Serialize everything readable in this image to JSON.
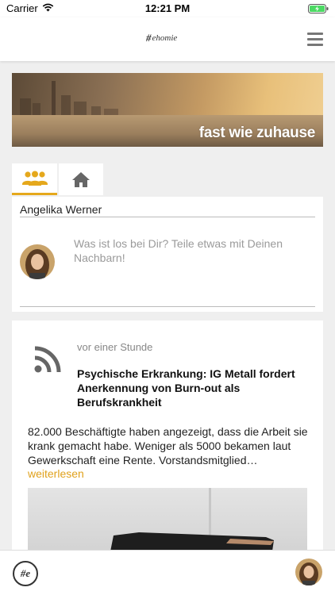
{
  "status_bar": {
    "carrier": "Carrier",
    "time": "12:21 PM"
  },
  "header": {
    "logo_text": "ehomie",
    "logo_mark": "#"
  },
  "banner": {
    "text": "fast wie zuhause"
  },
  "tabs": [
    {
      "icon": "people-icon",
      "active": true
    },
    {
      "icon": "home-icon",
      "active": false
    }
  ],
  "composer": {
    "user_name": "Angelika Werner",
    "placeholder": "Was ist los bei Dir? Teile etwas mit Deinen Nachbarn!"
  },
  "post": {
    "icon": "rss-icon",
    "time": "vor einer Stunde",
    "title": "Psychische Erkrankung: IG Metall fordert Anerkennung von Burn-out als Berufskrankheit",
    "body": "82.000 Beschäftigte haben angezeigt, dass die Arbeit sie krank gemacht habe. Weniger als 5000 bekamen laut Gewerkschaft eine Rente. Vorstandsmitglied…",
    "read_more": "weiterlesen"
  },
  "bottom_bar": {
    "logo_text": "#e"
  },
  "colors": {
    "accent": "#e5a81c",
    "link": "#e0a11c",
    "background": "#efefef"
  }
}
